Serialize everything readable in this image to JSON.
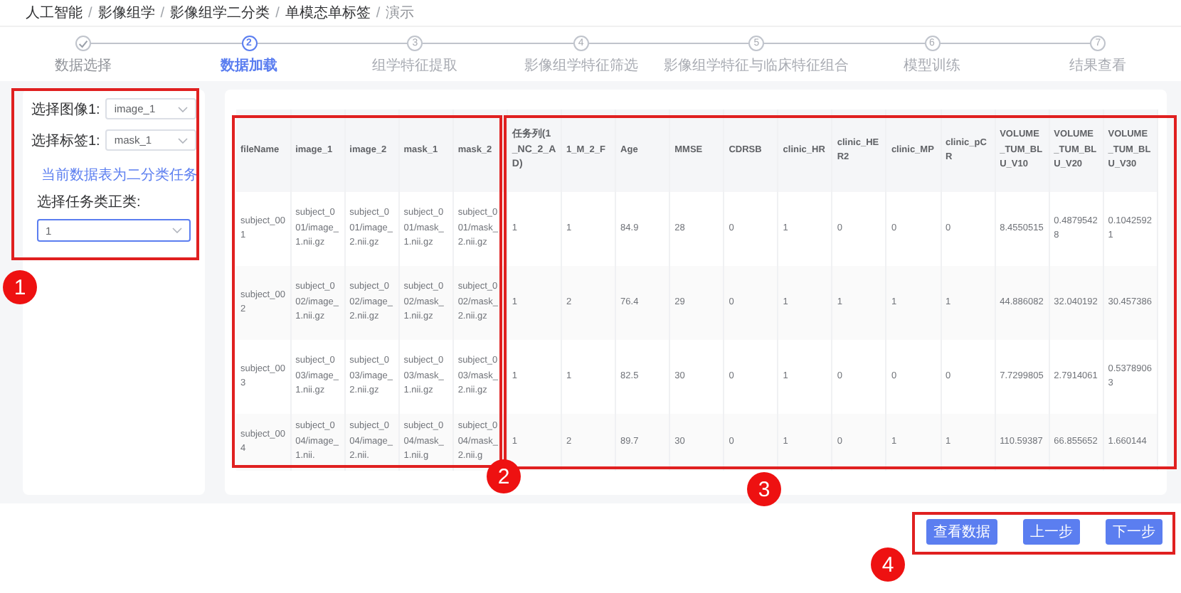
{
  "breadcrumb": {
    "separator": "/",
    "items": [
      "人工智能",
      "影像组学",
      "影像组学二分类",
      "单模态单标签",
      "演示"
    ]
  },
  "steps": [
    {
      "label": "数据选择",
      "completed": true,
      "selected": false
    },
    {
      "label": "数据加载",
      "number": "2",
      "completed": false,
      "selected": true
    },
    {
      "label": "组学特征提取",
      "number": "3",
      "completed": false,
      "selected": false
    },
    {
      "label": "影像组学特征筛选",
      "number": "4",
      "completed": false,
      "selected": false
    },
    {
      "label": "影像组学特征与临床特征组合",
      "number": "5",
      "completed": false,
      "selected": false
    },
    {
      "label": "模型训练",
      "number": "6",
      "completed": false,
      "selected": false
    },
    {
      "label": "结果查看",
      "number": "7",
      "completed": false,
      "selected": false
    }
  ],
  "form": {
    "image_select": {
      "label": "选择图像1:",
      "value": "image_1"
    },
    "label_select": {
      "label": "选择标签1:",
      "value": "mask_1"
    },
    "info": "当前数据表为二分类任务",
    "task_select": {
      "label": "选择任务类正类:",
      "value": "1",
      "focused": true
    }
  },
  "table": {
    "columns": [
      "fileName",
      "image_1",
      "image_2",
      "mask_1",
      "mask_2",
      "任务列(1_NC_2_AD)",
      "1_M_2_F",
      "Age",
      "MMSE",
      "CDRSB",
      "clinic_HR",
      "clinic_HER2",
      "clinic_MP",
      "clinic_pCR",
      "VOLUME_TUM_BLU_V10",
      "VOLUME_TUM_BLU_V20",
      "VOLUME_TUM_BLU_V30"
    ],
    "rows": [
      [
        "subject_001",
        "subject_001/image_1.nii.gz",
        "subject_001/image_2.nii.gz",
        "subject_001/mask_1.nii.gz",
        "subject_001/mask_2.nii.gz",
        "1",
        "1",
        "84.9",
        "28",
        "0",
        "1",
        "0",
        "0",
        "0",
        "8.4550515",
        "0.48795428",
        "0.10425921"
      ],
      [
        "subject_002",
        "subject_002/image_1.nii.gz",
        "subject_002/image_2.nii.gz",
        "subject_002/mask_1.nii.gz",
        "subject_002/mask_2.nii.gz",
        "1",
        "2",
        "76.4",
        "29",
        "0",
        "1",
        "1",
        "1",
        "1",
        "44.886082",
        "32.040192",
        "30.457386"
      ],
      [
        "subject_003",
        "subject_003/image_1.nii.gz",
        "subject_003/image_2.nii.gz",
        "subject_003/mask_1.nii.gz",
        "subject_003/mask_2.nii.gz",
        "1",
        "1",
        "82.5",
        "30",
        "0",
        "1",
        "0",
        "0",
        "0",
        "7.7299805",
        "2.7914061",
        "0.53789063"
      ],
      [
        "subject_004",
        "subject_004/image_1.nii.",
        "subject_004/image_2.nii.",
        "subject_004/mask_1.nii.g",
        "subject_004/mask_2.nii.g",
        "1",
        "2",
        "89.7",
        "30",
        "0",
        "1",
        "0",
        "1",
        "1",
        "110.59387",
        "66.855652",
        "1.660144"
      ]
    ]
  },
  "buttons": [
    "查看数据",
    "上一步",
    "下一步"
  ],
  "annotations": [
    "1",
    "2",
    "3",
    "4"
  ]
}
